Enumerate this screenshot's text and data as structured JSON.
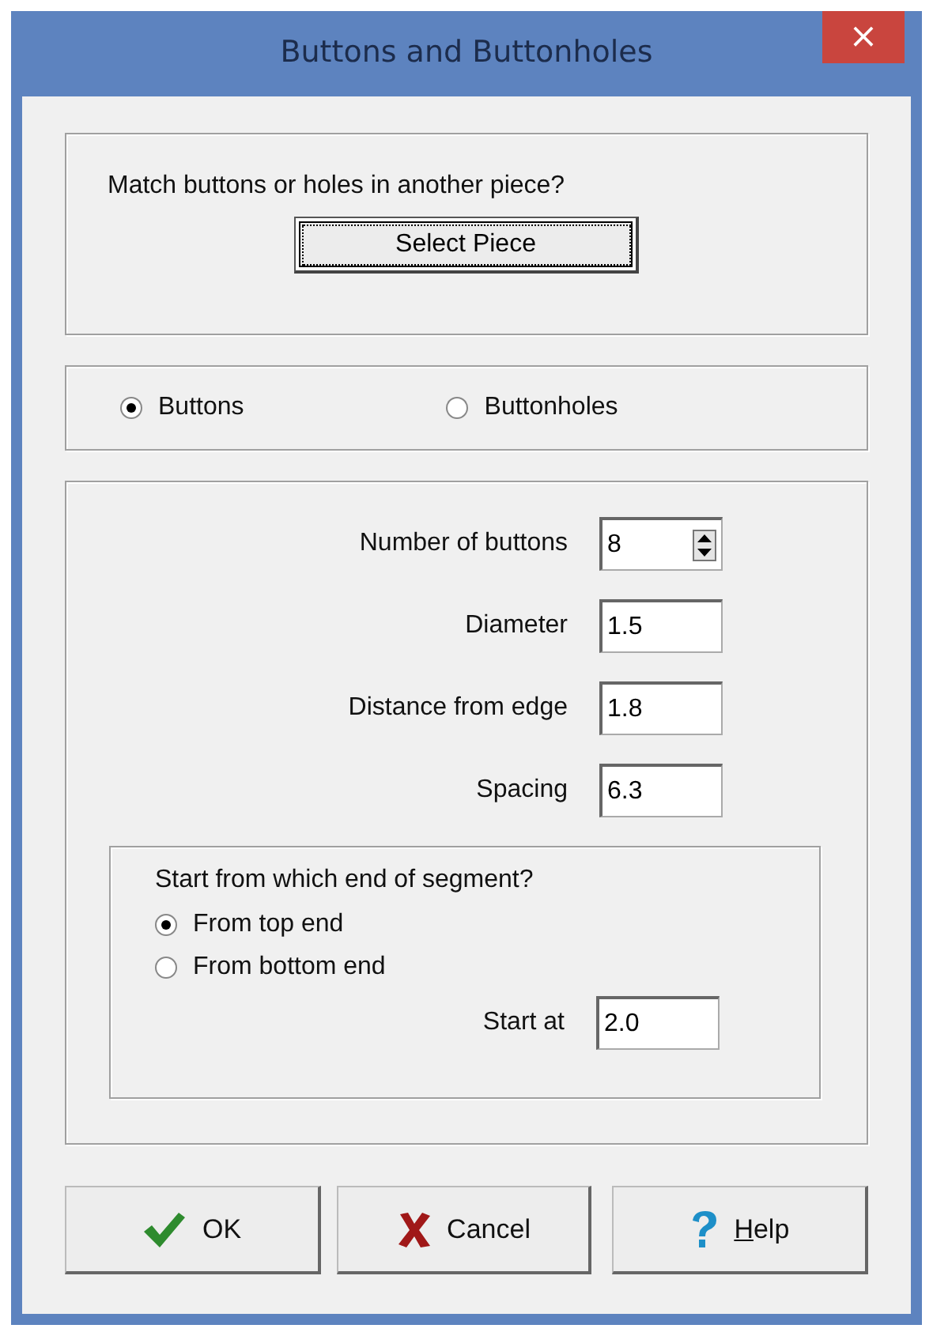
{
  "window": {
    "title": "Buttons and Buttonholes",
    "close": "×"
  },
  "match": {
    "prompt": "Match buttons or holes in another piece?",
    "button": "Select Piece"
  },
  "type_options": [
    {
      "label": "Buttons",
      "selected": true
    },
    {
      "label": "Buttonholes",
      "selected": false
    }
  ],
  "fields": [
    {
      "label": "Number of buttons",
      "value": "8",
      "kind": "spinner"
    },
    {
      "label": "Diameter",
      "value": "1.5",
      "kind": "text"
    },
    {
      "label": "Distance from edge",
      "value": "1.8",
      "kind": "text"
    },
    {
      "label": "Spacing",
      "value": "6.3",
      "kind": "text"
    }
  ],
  "start": {
    "question": "Start from which end of segment?",
    "options": [
      {
        "label": "From top end",
        "selected": true
      },
      {
        "label": "From bottom end",
        "selected": false
      }
    ],
    "start_label": "Start at",
    "start_value": "2.0"
  },
  "buttons": [
    {
      "label": "OK",
      "kind": "ok"
    },
    {
      "label": "Cancel",
      "kind": "cancel"
    },
    {
      "label": "Help",
      "kind": "help"
    }
  ]
}
